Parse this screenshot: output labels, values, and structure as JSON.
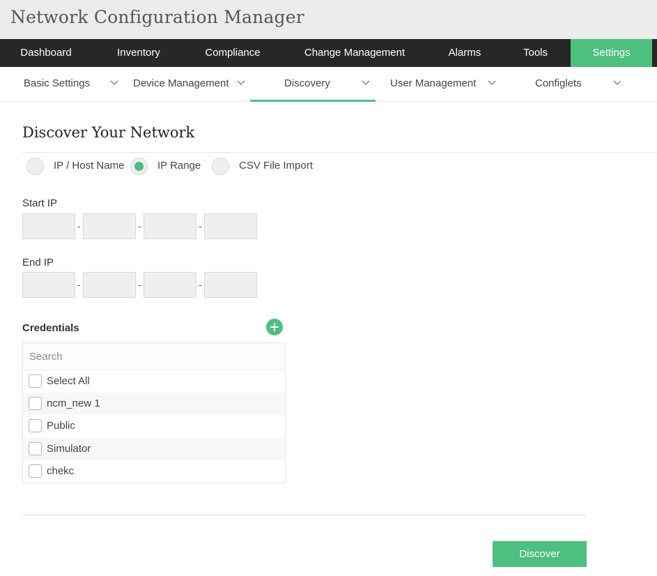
{
  "app": {
    "title": "Network Configuration Manager"
  },
  "main_nav": [
    {
      "label": "Dashboard",
      "active": false
    },
    {
      "label": "Inventory",
      "active": false
    },
    {
      "label": "Compliance",
      "active": false
    },
    {
      "label": "Change Management",
      "active": false
    },
    {
      "label": "Alarms",
      "active": false
    },
    {
      "label": "Tools",
      "active": false
    },
    {
      "label": "Settings",
      "active": true
    }
  ],
  "sub_nav": [
    {
      "label": "Basic Settings",
      "active": false
    },
    {
      "label": "Device Management",
      "active": false
    },
    {
      "label": "Discovery",
      "active": true
    },
    {
      "label": "User Management",
      "active": false
    },
    {
      "label": "Configlets",
      "active": false
    }
  ],
  "page": {
    "title": "Discover Your Network"
  },
  "discovery_mode": {
    "options": [
      {
        "label": "IP / Host Name",
        "selected": false
      },
      {
        "label": "IP Range",
        "selected": true
      },
      {
        "label": "CSV File Import",
        "selected": false
      }
    ]
  },
  "start_ip": {
    "label": "Start IP",
    "octets": [
      "",
      "",
      "",
      ""
    ],
    "separator": "-"
  },
  "end_ip": {
    "label": "End IP",
    "octets": [
      "",
      "",
      "",
      ""
    ],
    "separator": "-"
  },
  "credentials": {
    "label": "Credentials",
    "search_placeholder": "Search",
    "select_all_label": "Select All",
    "items": [
      {
        "label": "ncm_new 1",
        "checked": false
      },
      {
        "label": "Public",
        "checked": false
      },
      {
        "label": "Simulator",
        "checked": false
      },
      {
        "label": "chekc",
        "checked": false
      }
    ]
  },
  "actions": {
    "discover_label": "Discover"
  },
  "colors": {
    "accent": "#4dbf7e",
    "nav_bg": "#272727",
    "titlebar_bg": "#ececec"
  }
}
